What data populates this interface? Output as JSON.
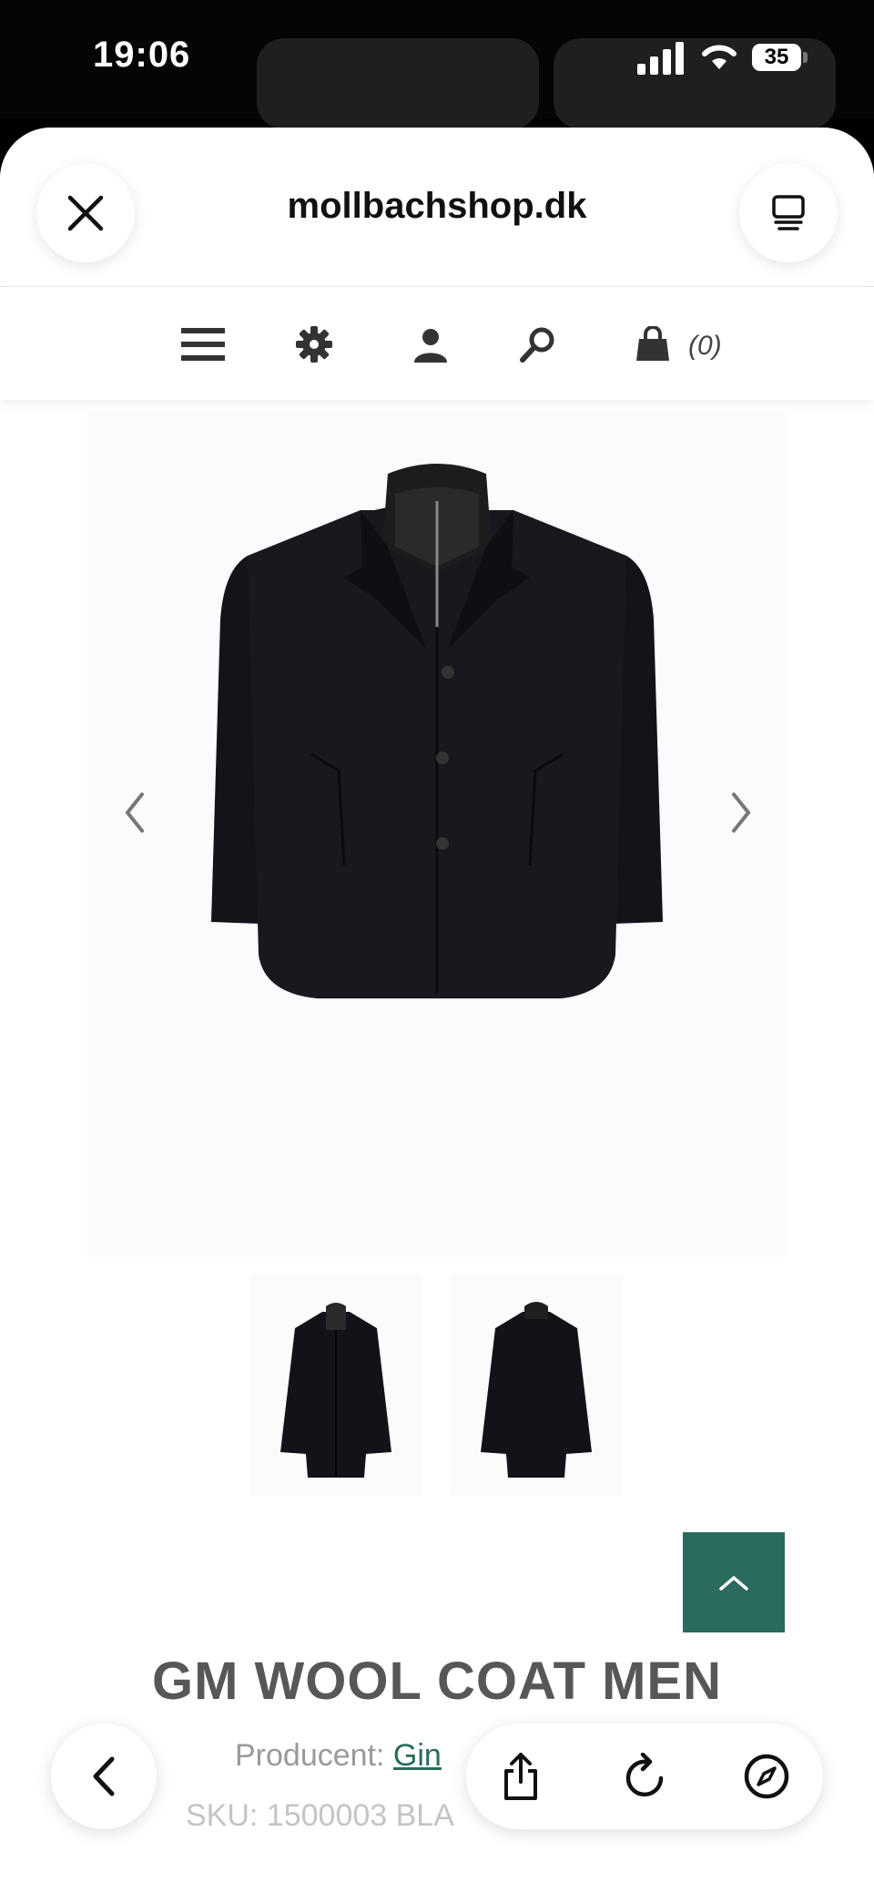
{
  "status_bar": {
    "time": "19:06",
    "battery": "35"
  },
  "browser": {
    "site_title": "mollbachshop.dk"
  },
  "shop_nav": {
    "cart_count": "(0)"
  },
  "product": {
    "title": "GM WOOL COAT MEN",
    "producer_label": "Producent:",
    "producer_value": "Gin",
    "sku_text": "SKU: 1500003 BLA"
  },
  "colors": {
    "accent": "#2a6b5d",
    "text": "#575757"
  },
  "icons": [
    "close-icon",
    "tab-overview-icon",
    "menu-icon",
    "settings-gear-icon",
    "user-icon",
    "search-icon",
    "shopping-bag-icon",
    "chevron-left-icon",
    "chevron-right-icon",
    "chevron-up-icon",
    "back-icon",
    "share-icon",
    "reload-icon",
    "compass-icon"
  ]
}
